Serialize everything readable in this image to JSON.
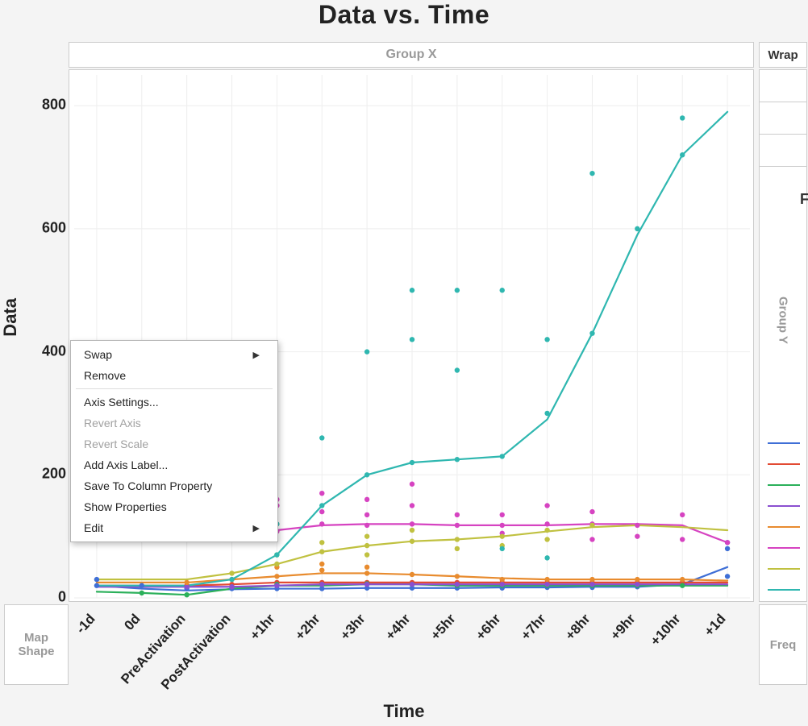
{
  "title": "Data vs. Time",
  "panel_top_label": "Group X",
  "panel_right": {
    "label": "Group Y",
    "corner": "F"
  },
  "wrap_label": "Wrap",
  "freq_label": "Freq",
  "map_shape_label": "Map\nShape",
  "ylabel": "Data",
  "xlabel": "Time",
  "context_menu": {
    "items": [
      {
        "label": "Swap",
        "submenu": true,
        "enabled": true
      },
      {
        "label": "Remove",
        "submenu": false,
        "enabled": true
      },
      {
        "sep": true
      },
      {
        "label": "Axis Settings...",
        "submenu": false,
        "enabled": true
      },
      {
        "label": "Revert Axis",
        "submenu": false,
        "enabled": false
      },
      {
        "label": "Revert Scale",
        "submenu": false,
        "enabled": false
      },
      {
        "label": "Add Axis Label...",
        "submenu": false,
        "enabled": true
      },
      {
        "label": "Save To Column Property",
        "submenu": false,
        "enabled": true
      },
      {
        "label": "Show Properties",
        "submenu": false,
        "enabled": true
      },
      {
        "label": "Edit",
        "submenu": true,
        "enabled": true
      }
    ]
  },
  "chart_data": {
    "type": "scatter",
    "title": "Data vs. Time",
    "xlabel": "Time",
    "ylabel": "Data",
    "ylim": [
      0,
      850
    ],
    "y_ticks": [
      0,
      200,
      400,
      600,
      800
    ],
    "categories": [
      "-1d",
      "0d",
      "PreActivation",
      "PostActivation",
      "+1hr",
      "+2hr",
      "+3hr",
      "+4hr",
      "+5hr",
      "+6hr",
      "+7hr",
      "+8hr",
      "+9hr",
      "+10hr",
      "+1d"
    ],
    "panel_col": "Group X",
    "panel_row": "Group Y",
    "series": [
      {
        "name": "blue",
        "color": "#3f6fd6",
        "line": [
          20,
          15,
          12,
          14,
          15,
          15,
          16,
          16,
          16,
          17,
          17,
          18,
          18,
          22,
          50
        ],
        "points": [
          [
            0,
            20
          ],
          [
            0,
            30
          ],
          [
            1,
            20
          ],
          [
            2,
            15
          ],
          [
            3,
            15
          ],
          [
            4,
            15
          ],
          [
            5,
            15
          ],
          [
            6,
            16
          ],
          [
            7,
            16
          ],
          [
            8,
            16
          ],
          [
            9,
            16
          ],
          [
            10,
            17
          ],
          [
            11,
            17
          ],
          [
            12,
            18
          ],
          [
            13,
            25
          ],
          [
            14,
            35
          ],
          [
            14,
            80
          ],
          [
            14,
            90
          ]
        ]
      },
      {
        "name": "red",
        "color": "#e24a33",
        "line": [
          20,
          20,
          20,
          22,
          25,
          25,
          25,
          25,
          25,
          25,
          25,
          25,
          25,
          25,
          25
        ],
        "points": [
          [
            2,
            20
          ],
          [
            3,
            22
          ],
          [
            4,
            25
          ],
          [
            5,
            25
          ],
          [
            6,
            25
          ],
          [
            7,
            25
          ],
          [
            8,
            25
          ],
          [
            9,
            25
          ],
          [
            10,
            25
          ],
          [
            11,
            25
          ],
          [
            12,
            25
          ],
          [
            13,
            25
          ]
        ]
      },
      {
        "name": "green",
        "color": "#2bb05a",
        "line": [
          10,
          8,
          5,
          15,
          20,
          20,
          22,
          22,
          20,
          20,
          20,
          20,
          20,
          20,
          20
        ],
        "points": [
          [
            1,
            8
          ],
          [
            2,
            5
          ],
          [
            3,
            18
          ],
          [
            4,
            22
          ],
          [
            5,
            22
          ],
          [
            6,
            23
          ],
          [
            7,
            22
          ],
          [
            8,
            20
          ],
          [
            9,
            20
          ],
          [
            10,
            20
          ],
          [
            11,
            20
          ],
          [
            12,
            20
          ],
          [
            13,
            20
          ]
        ]
      },
      {
        "name": "purple",
        "color": "#8b4fd0",
        "line": [
          18,
          18,
          18,
          18,
          20,
          22,
          22,
          22,
          22,
          22,
          22,
          22,
          22,
          22,
          22
        ],
        "points": [
          [
            2,
            18
          ],
          [
            3,
            18
          ],
          [
            4,
            20
          ],
          [
            5,
            22
          ],
          [
            6,
            22
          ],
          [
            7,
            22
          ],
          [
            8,
            22
          ],
          [
            9,
            22
          ],
          [
            10,
            22
          ],
          [
            11,
            22
          ],
          [
            12,
            22
          ]
        ]
      },
      {
        "name": "orange",
        "color": "#e88b2e",
        "line": [
          25,
          25,
          25,
          30,
          35,
          40,
          40,
          38,
          35,
          32,
          30,
          30,
          30,
          30,
          28
        ],
        "points": [
          [
            2,
            25
          ],
          [
            3,
            30
          ],
          [
            4,
            35
          ],
          [
            4,
            50
          ],
          [
            5,
            45
          ],
          [
            5,
            55
          ],
          [
            6,
            40
          ],
          [
            6,
            50
          ],
          [
            7,
            38
          ],
          [
            8,
            35
          ],
          [
            9,
            30
          ],
          [
            10,
            30
          ],
          [
            11,
            30
          ],
          [
            12,
            30
          ],
          [
            13,
            30
          ]
        ]
      },
      {
        "name": "magenta",
        "color": "#d643c1",
        "line": [
          100,
          105,
          105,
          108,
          110,
          118,
          120,
          120,
          118,
          118,
          118,
          120,
          120,
          118,
          90
        ],
        "points": [
          [
            3,
            100
          ],
          [
            4,
            108
          ],
          [
            4,
            150
          ],
          [
            4,
            160
          ],
          [
            5,
            120
          ],
          [
            5,
            140
          ],
          [
            5,
            170
          ],
          [
            6,
            118
          ],
          [
            6,
            135
          ],
          [
            6,
            160
          ],
          [
            7,
            120
          ],
          [
            7,
            185
          ],
          [
            7,
            150
          ],
          [
            8,
            118
          ],
          [
            8,
            135
          ],
          [
            9,
            118
          ],
          [
            9,
            135
          ],
          [
            9,
            105
          ],
          [
            10,
            120
          ],
          [
            10,
            150
          ],
          [
            11,
            120
          ],
          [
            11,
            95
          ],
          [
            11,
            140
          ],
          [
            12,
            118
          ],
          [
            12,
            100
          ],
          [
            13,
            135
          ],
          [
            13,
            95
          ],
          [
            14,
            90
          ]
        ]
      },
      {
        "name": "olive",
        "color": "#c0c140",
        "line": [
          30,
          30,
          30,
          40,
          55,
          75,
          85,
          92,
          95,
          100,
          108,
          115,
          118,
          115,
          110
        ],
        "points": [
          [
            3,
            40
          ],
          [
            4,
            55
          ],
          [
            4,
            70
          ],
          [
            5,
            75
          ],
          [
            5,
            90
          ],
          [
            6,
            85
          ],
          [
            6,
            100
          ],
          [
            6,
            70
          ],
          [
            7,
            92
          ],
          [
            7,
            110
          ],
          [
            8,
            95
          ],
          [
            8,
            80
          ],
          [
            9,
            100
          ],
          [
            9,
            85
          ],
          [
            10,
            110
          ],
          [
            10,
            95
          ],
          [
            11,
            118
          ]
        ]
      },
      {
        "name": "teal",
        "color": "#2fb7b0",
        "line": [
          20,
          20,
          20,
          30,
          70,
          150,
          200,
          220,
          225,
          230,
          290,
          430,
          590,
          720,
          790
        ],
        "points": [
          [
            3,
            30
          ],
          [
            4,
            70
          ],
          [
            4,
            120
          ],
          [
            5,
            150
          ],
          [
            5,
            260
          ],
          [
            6,
            200
          ],
          [
            6,
            400
          ],
          [
            7,
            220
          ],
          [
            7,
            420
          ],
          [
            7,
            500
          ],
          [
            8,
            225
          ],
          [
            8,
            500
          ],
          [
            8,
            370
          ],
          [
            9,
            230
          ],
          [
            9,
            500
          ],
          [
            9,
            80
          ],
          [
            10,
            300
          ],
          [
            10,
            420
          ],
          [
            10,
            65
          ],
          [
            11,
            690
          ],
          [
            11,
            430
          ],
          [
            12,
            600
          ],
          [
            13,
            780
          ],
          [
            13,
            720
          ]
        ]
      }
    ]
  }
}
